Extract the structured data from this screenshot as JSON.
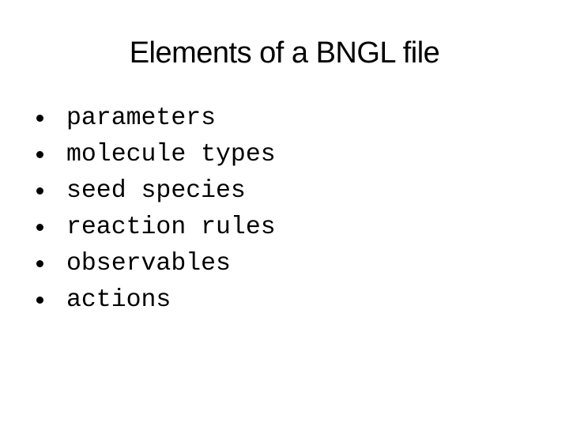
{
  "slide": {
    "title": "Elements of a BNGL file",
    "bullets": [
      {
        "label": "parameters"
      },
      {
        "label": "molecule types"
      },
      {
        "label": "seed species"
      },
      {
        "label": "reaction rules"
      },
      {
        "label": "observables"
      },
      {
        "label": "actions"
      }
    ]
  }
}
